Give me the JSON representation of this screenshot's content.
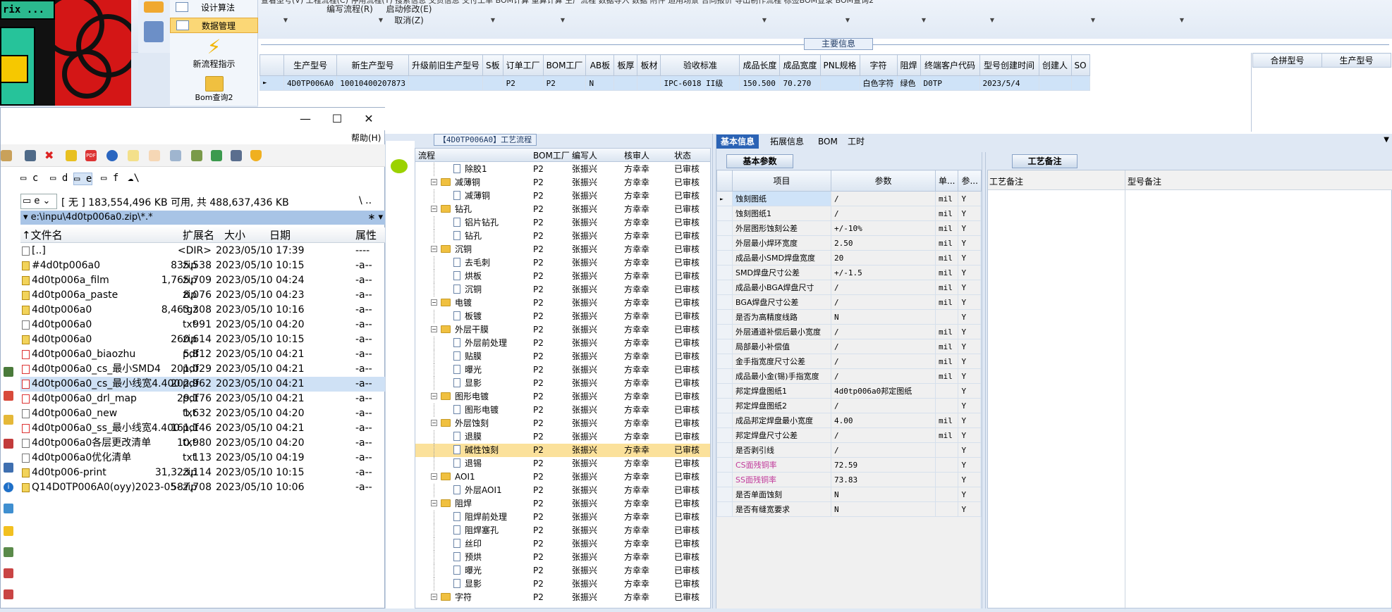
{
  "ribbon": {
    "top_cut_labels": [
      "查看型号(V)",
      "工程流程(C)",
      "停用流程(T)",
      "搜索信息",
      "交货信息",
      "交付工单",
      "BOM计算",
      "重算计算",
      "生产流程",
      "数据导入",
      "数据",
      "附件",
      "适用场景",
      "合同报价",
      "导出制作流程",
      "标签BOM登录",
      "BOM查询2"
    ],
    "buttons": [
      {
        "label": "编写流程(R)"
      },
      {
        "label": "启动修改(E)"
      },
      {
        "label": "取消(Z)"
      }
    ],
    "design_menu": {
      "design_algo": "设计算法",
      "data_mgmt": "数据管理",
      "new_flow": "新流程指示",
      "bom_query2": "Bom查询2"
    },
    "top_left_banner": "rix ..."
  },
  "main_info": {
    "tab_title": "主要信息",
    "columns": [
      "生产型号",
      "新生产型号",
      "升级前旧生产型号",
      "S板",
      "订单工厂",
      "BOM工厂",
      "AB板",
      "板厚",
      "板材",
      "验收标准",
      "成品长度",
      "成品宽度",
      "PNL规格",
      "字符",
      "阻焊",
      "终端客户代码",
      "型号创建时间",
      "创建人",
      "SO"
    ],
    "row": [
      "4D0TP006A0",
      "10010400207873",
      "",
      "",
      "P2",
      "P2",
      "N",
      "",
      "",
      "IPC-6018 II级",
      "150.500",
      "70.270",
      "",
      "白色字符",
      "绿色",
      "D0TP",
      "2023/5/4",
      "",
      ""
    ],
    "merge_columns": [
      "合拼型号",
      "生产型号"
    ]
  },
  "file_manager": {
    "help": "帮助(H)",
    "drives": [
      "c",
      "d",
      "e",
      "f",
      "\\"
    ],
    "drive_select": "e",
    "free_text": "[ 无 ]  183,554,496 KB 可用, 共 488,637,436 KB",
    "path_tail": "\\ ..",
    "path": "e:\\inpu\\4d0tp006a0.zip\\*.*",
    "columns": {
      "name": "文件名",
      "ext": "扩展名",
      "size": "大小",
      "date": "日期",
      "attr": "属性"
    },
    "files": [
      {
        "name": "[..]",
        "ext": "",
        "size": "<DIR>",
        "date": "2023/05/10 17:39",
        "attr": "----"
      },
      {
        "name": "#4d0tp006a0",
        "ext": "zip",
        "size": "835,538",
        "date": "2023/05/10 10:15",
        "attr": "-a--"
      },
      {
        "name": "4d0tp006a_film",
        "ext": "zip",
        "size": "1,765,709",
        "date": "2023/05/10 04:24",
        "attr": "-a--"
      },
      {
        "name": "4d0tp006a_paste",
        "ext": "zip",
        "size": "8,076",
        "date": "2023/05/10 04:23",
        "attr": "-a--"
      },
      {
        "name": "4d0tp006a0",
        "ext": "tgz",
        "size": "8,463,308",
        "date": "2023/05/10 10:16",
        "attr": "-a--"
      },
      {
        "name": "4d0tp006a0",
        "ext": "txt",
        "size": "991",
        "date": "2023/05/10 04:20",
        "attr": "-a--"
      },
      {
        "name": "4d0tp006a0",
        "ext": "zip",
        "size": "260,614",
        "date": "2023/05/10 10:15",
        "attr": "-a--"
      },
      {
        "name": "4d0tp006a0_biaozhu",
        "ext": "pdf",
        "size": "5,812",
        "date": "2023/05/10 04:21",
        "attr": "-a--"
      },
      {
        "name": "4d0tp006a0_cs_最小SMD4",
        "ext": "pdf",
        "size": "201,029",
        "date": "2023/05/10 04:21",
        "attr": "-a--"
      },
      {
        "name": "4d0tp006a0_cs_最小线宽4.400",
        "ext": "pdf",
        "size": "202,962",
        "date": "2023/05/10 04:21",
        "attr": "-a--"
      },
      {
        "name": "4d0tp006a0_drl_map",
        "ext": "pdf",
        "size": "29,176",
        "date": "2023/05/10 04:21",
        "attr": "-a--"
      },
      {
        "name": "4d0tp006a0_new",
        "ext": "txt",
        "size": "1,632",
        "date": "2023/05/10 04:20",
        "attr": "-a--"
      },
      {
        "name": "4d0tp006a0_ss_最小线宽4.400",
        "ext": "pdf",
        "size": "161,146",
        "date": "2023/05/10 04:21",
        "attr": "-a--"
      },
      {
        "name": "4d0tp006a0各层更改清单",
        "ext": "txt",
        "size": "10,980",
        "date": "2023/05/10 04:20",
        "attr": "-a--"
      },
      {
        "name": "4d0tp006a0优化清单",
        "ext": "txt",
        "size": "113",
        "date": "2023/05/10 04:19",
        "attr": "-a--"
      },
      {
        "name": "4d0tp006-print",
        "ext": "zip",
        "size": "31,323,114",
        "date": "2023/05/10 10:15",
        "attr": "-a--"
      },
      {
        "name": "Q14D0TP006A0(oyy)2023-05-..",
        "ext": "zip",
        "size": "587,708",
        "date": "2023/05/10 10:06",
        "attr": "-a--"
      }
    ]
  },
  "process": {
    "title": "【4D0TP006A0】工艺流程",
    "columns": [
      "流程",
      "BOM工厂",
      "编写人",
      "核审人",
      "状态"
    ],
    "rows": [
      {
        "name": "除胶1",
        "level": 2,
        "bom": "P2",
        "writer": "张振兴",
        "reviewer": "方幸幸",
        "status": "已审核"
      },
      {
        "name": "减薄铜",
        "level": 1,
        "bom": "P2",
        "writer": "张振兴",
        "reviewer": "方幸幸",
        "status": "已审核"
      },
      {
        "name": "减薄铜",
        "level": 2,
        "bom": "P2",
        "writer": "张振兴",
        "reviewer": "方幸幸",
        "status": "已审核"
      },
      {
        "name": "钻孔",
        "level": 1,
        "bom": "P2",
        "writer": "张振兴",
        "reviewer": "方幸幸",
        "status": "已审核"
      },
      {
        "name": "铝片钻孔",
        "level": 2,
        "bom": "P2",
        "writer": "张振兴",
        "reviewer": "方幸幸",
        "status": "已审核"
      },
      {
        "name": "钻孔",
        "level": 2,
        "bom": "P2",
        "writer": "张振兴",
        "reviewer": "方幸幸",
        "status": "已审核"
      },
      {
        "name": "沉铜",
        "level": 1,
        "bom": "P2",
        "writer": "张振兴",
        "reviewer": "方幸幸",
        "status": "已审核"
      },
      {
        "name": "去毛刺",
        "level": 2,
        "bom": "P2",
        "writer": "张振兴",
        "reviewer": "方幸幸",
        "status": "已审核"
      },
      {
        "name": "烘板",
        "level": 2,
        "bom": "P2",
        "writer": "张振兴",
        "reviewer": "方幸幸",
        "status": "已审核"
      },
      {
        "name": "沉铜",
        "level": 2,
        "bom": "P2",
        "writer": "张振兴",
        "reviewer": "方幸幸",
        "status": "已审核"
      },
      {
        "name": "电镀",
        "level": 1,
        "bom": "P2",
        "writer": "张振兴",
        "reviewer": "方幸幸",
        "status": "已审核"
      },
      {
        "name": "板镀",
        "level": 2,
        "bom": "P2",
        "writer": "张振兴",
        "reviewer": "方幸幸",
        "status": "已审核"
      },
      {
        "name": "外层干膜",
        "level": 1,
        "bom": "P2",
        "writer": "张振兴",
        "reviewer": "方幸幸",
        "status": "已审核"
      },
      {
        "name": "外层前处理",
        "level": 2,
        "bom": "P2",
        "writer": "张振兴",
        "reviewer": "方幸幸",
        "status": "已审核"
      },
      {
        "name": "贴膜",
        "level": 2,
        "bom": "P2",
        "writer": "张振兴",
        "reviewer": "方幸幸",
        "status": "已审核"
      },
      {
        "name": "曝光",
        "level": 2,
        "bom": "P2",
        "writer": "张振兴",
        "reviewer": "方幸幸",
        "status": "已审核"
      },
      {
        "name": "显影",
        "level": 2,
        "bom": "P2",
        "writer": "张振兴",
        "reviewer": "方幸幸",
        "status": "已审核"
      },
      {
        "name": "图形电镀",
        "level": 1,
        "bom": "P2",
        "writer": "张振兴",
        "reviewer": "方幸幸",
        "status": "已审核"
      },
      {
        "name": "图形电镀",
        "level": 2,
        "bom": "P2",
        "writer": "张振兴",
        "reviewer": "方幸幸",
        "status": "已审核"
      },
      {
        "name": "外层蚀刻",
        "level": 1,
        "bom": "P2",
        "writer": "张振兴",
        "reviewer": "方幸幸",
        "status": "已审核"
      },
      {
        "name": "退膜",
        "level": 2,
        "bom": "P2",
        "writer": "张振兴",
        "reviewer": "方幸幸",
        "status": "已审核"
      },
      {
        "name": "碱性蚀刻",
        "level": 2,
        "bom": "P2",
        "writer": "张振兴",
        "reviewer": "方幸幸",
        "status": "已审核",
        "selected": true
      },
      {
        "name": "退锡",
        "level": 2,
        "bom": "P2",
        "writer": "张振兴",
        "reviewer": "方幸幸",
        "status": "已审核"
      },
      {
        "name": "AOI1",
        "level": 1,
        "bom": "P2",
        "writer": "张振兴",
        "reviewer": "方幸幸",
        "status": "已审核"
      },
      {
        "name": "外层AOI1",
        "level": 2,
        "bom": "P2",
        "writer": "张振兴",
        "reviewer": "方幸幸",
        "status": "已审核"
      },
      {
        "name": "阻焊",
        "level": 1,
        "bom": "P2",
        "writer": "张振兴",
        "reviewer": "方幸幸",
        "status": "已审核"
      },
      {
        "name": "阻焊前处理",
        "level": 2,
        "bom": "P2",
        "writer": "张振兴",
        "reviewer": "方幸幸",
        "status": "已审核"
      },
      {
        "name": "阻焊塞孔",
        "level": 2,
        "bom": "P2",
        "writer": "张振兴",
        "reviewer": "方幸幸",
        "status": "已审核"
      },
      {
        "name": "丝印",
        "level": 2,
        "bom": "P2",
        "writer": "张振兴",
        "reviewer": "方幸幸",
        "status": "已审核"
      },
      {
        "name": "预烘",
        "level": 2,
        "bom": "P2",
        "writer": "张振兴",
        "reviewer": "方幸幸",
        "status": "已审核"
      },
      {
        "name": "曝光",
        "level": 2,
        "bom": "P2",
        "writer": "张振兴",
        "reviewer": "方幸幸",
        "status": "已审核"
      },
      {
        "name": "显影",
        "level": 2,
        "bom": "P2",
        "writer": "张振兴",
        "reviewer": "方幸幸",
        "status": "已审核"
      },
      {
        "name": "字符",
        "level": 1,
        "bom": "P2",
        "writer": "张振兴",
        "reviewer": "方幸幸",
        "status": "已审核"
      }
    ]
  },
  "basic_info": {
    "tabs": [
      "基本信息",
      "拓展信息",
      "BOM",
      "工时"
    ],
    "param_tab": "基本参数",
    "columns": [
      "项目",
      "参数",
      "单...",
      "参..."
    ],
    "rows": [
      {
        "item": "蚀刻图纸",
        "value": "/",
        "unit": "mil",
        "flag": "Y"
      },
      {
        "item": "蚀刻图纸1",
        "value": "/",
        "unit": "mil",
        "flag": "Y"
      },
      {
        "item": "外层图形蚀刻公差",
        "value": "+/-10%",
        "unit": "mil",
        "flag": "Y"
      },
      {
        "item": "外层最小焊环宽度",
        "value": "2.50",
        "unit": "mil",
        "flag": "Y"
      },
      {
        "item": "成品最小SMD焊盘宽度",
        "value": "20",
        "unit": "mil",
        "flag": "Y"
      },
      {
        "item": "SMD焊盘尺寸公差",
        "value": "+/-1.5",
        "unit": "mil",
        "flag": "Y"
      },
      {
        "item": "成品最小BGA焊盘尺寸",
        "value": "/",
        "unit": "mil",
        "flag": "Y"
      },
      {
        "item": "BGA焊盘尺寸公差",
        "value": "/",
        "unit": "mil",
        "flag": "Y"
      },
      {
        "item": "是否为高精度线路",
        "value": "N",
        "unit": "",
        "flag": "Y"
      },
      {
        "item": "外层通道补偿后最小宽度",
        "value": "/",
        "unit": "mil",
        "flag": "Y"
      },
      {
        "item": "局部最小补偿值",
        "value": "/",
        "unit": "mil",
        "flag": "Y"
      },
      {
        "item": "金手指宽度尺寸公差",
        "value": "/",
        "unit": "mil",
        "flag": "Y"
      },
      {
        "item": "成品最小金(锡)手指宽度",
        "value": "/",
        "unit": "mil",
        "flag": "Y"
      },
      {
        "item": "邦定焊盘图纸1",
        "value": "4d0tp006a0邦定图纸",
        "unit": "",
        "flag": "Y"
      },
      {
        "item": "邦定焊盘图纸2",
        "value": "/",
        "unit": "",
        "flag": "Y"
      },
      {
        "item": "成品邦定焊盘最小宽度",
        "value": "4.00",
        "unit": "mil",
        "flag": "Y"
      },
      {
        "item": "邦定焊盘尺寸公差",
        "value": "/",
        "unit": "mil",
        "flag": "Y"
      },
      {
        "item": "是否剥引线",
        "value": "/",
        "unit": "",
        "flag": "Y"
      },
      {
        "item": "CS面残铜率",
        "value": "72.59",
        "unit": "",
        "flag": "Y",
        "pink": true
      },
      {
        "item": "SS面残铜率",
        "value": "73.83",
        "unit": "",
        "flag": "Y",
        "pink": true
      },
      {
        "item": "是否单面蚀刻",
        "value": "N",
        "unit": "",
        "flag": "Y"
      },
      {
        "item": "是否有缝宽要求",
        "value": "N",
        "unit": "",
        "flag": "Y"
      }
    ]
  },
  "notes": {
    "tab": "工艺备注",
    "col_process": "工艺备注",
    "col_model": "型号备注"
  }
}
